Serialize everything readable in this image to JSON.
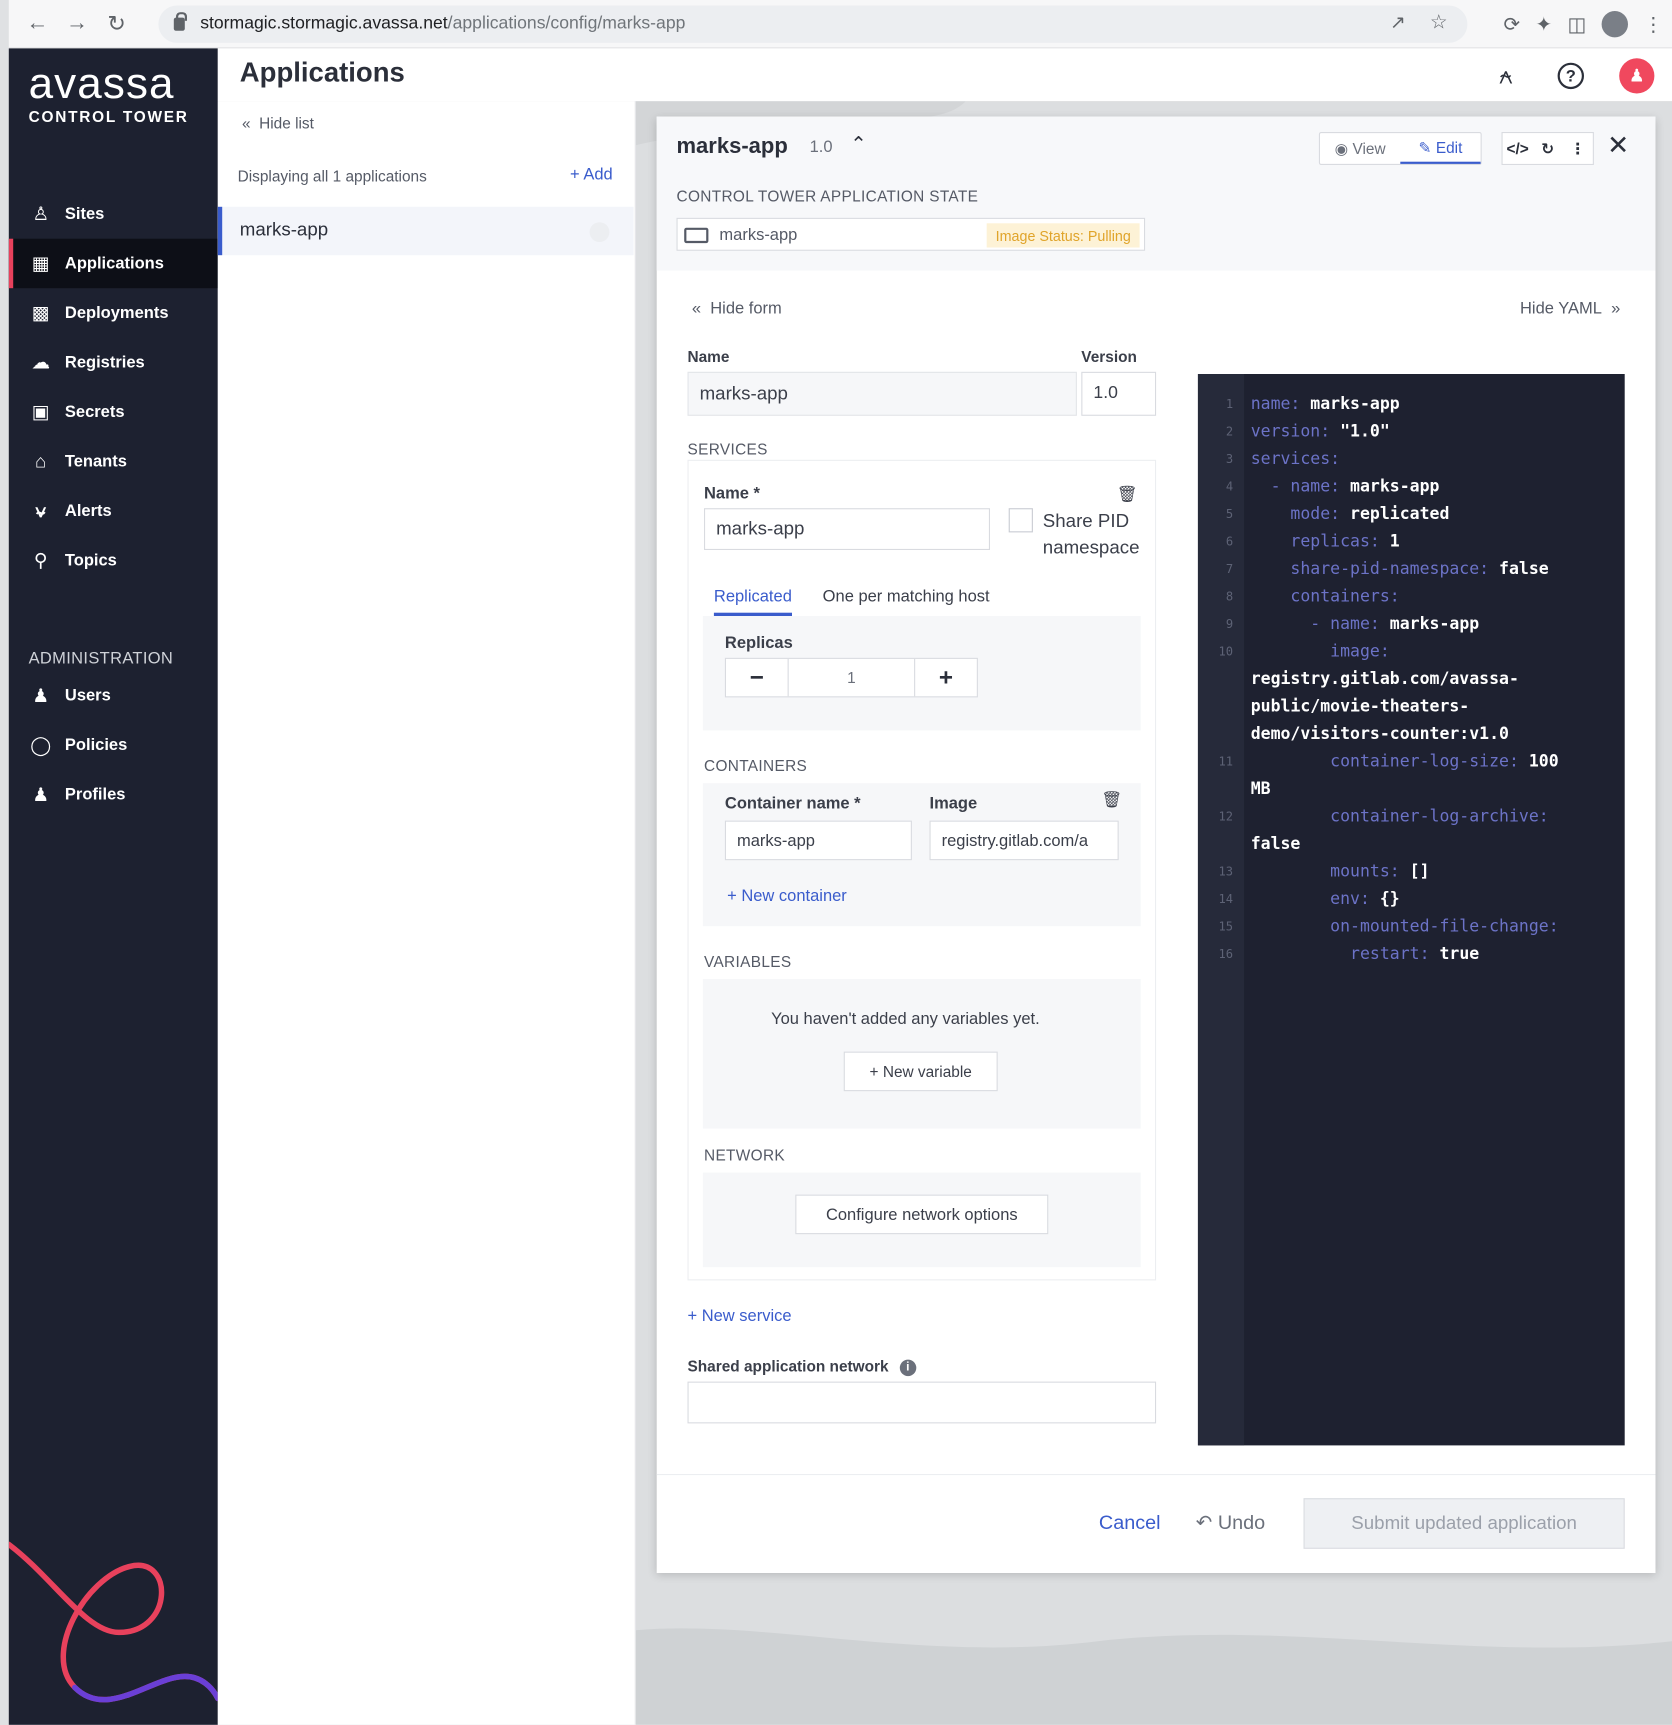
{
  "browser": {
    "url_host": "stormagic.stormagic.avassa.net",
    "url_path": "/applications/config/marks-app"
  },
  "brand": {
    "logo_word": "avassa",
    "logo_sub": "CONTROL TOWER",
    "accent": "#e8415c",
    "link": "#3a5ccc",
    "sidebar_bg": "#1d2130"
  },
  "sidebar": {
    "items": [
      {
        "label": "Sites",
        "icon": "sites-icon"
      },
      {
        "label": "Applications",
        "icon": "applications-icon"
      },
      {
        "label": "Deployments",
        "icon": "deployments-icon"
      },
      {
        "label": "Registries",
        "icon": "registries-icon"
      },
      {
        "label": "Secrets",
        "icon": "secrets-icon"
      },
      {
        "label": "Tenants",
        "icon": "tenants-icon"
      },
      {
        "label": "Alerts",
        "icon": "bell-icon"
      },
      {
        "label": "Topics",
        "icon": "search-icon"
      }
    ],
    "admin_title": "ADMINISTRATION",
    "admin_items": [
      {
        "label": "Users",
        "icon": "users-icon"
      },
      {
        "label": "Policies",
        "icon": "shield-icon"
      },
      {
        "label": "Profiles",
        "icon": "profiles-icon"
      }
    ]
  },
  "header": {
    "title": "Applications"
  },
  "list": {
    "hide_label": "Hide list",
    "displaying": "Displaying all 1 applications",
    "add_label": "+ Add",
    "rows": [
      {
        "label": "marks-app"
      }
    ]
  },
  "app": {
    "name": "marks-app",
    "version": "1.0",
    "view_label": "View",
    "edit_label": "Edit",
    "state_title": "CONTROL TOWER APPLICATION STATE",
    "state_name": "marks-app",
    "image_status": "Image Status: Pulling"
  },
  "form": {
    "hide_form": "Hide form",
    "hide_yaml": "Hide YAML",
    "name_label": "Name",
    "name_value": "marks-app",
    "version_label": "Version",
    "version_value": "1.0",
    "services_title": "SERVICES",
    "svc_name_label": "Name *",
    "svc_name_value": "marks-app",
    "share_pid_label": "Share PID",
    "share_pid_label2": "namespace",
    "tab_replicated": "Replicated",
    "tab_one_per_host": "One per matching host",
    "replicas_label": "Replicas",
    "replicas_value": "1",
    "containers_title": "CONTAINERS",
    "container_name_label": "Container name *",
    "container_name_value": "marks-app",
    "image_label": "Image",
    "image_value": "registry.gitlab.com/a",
    "new_container": "+ New container",
    "variables_title": "VARIABLES",
    "variables_empty": "You haven't added any variables yet.",
    "new_variable": "+ New variable",
    "network_title": "NETWORK",
    "configure_network": "Configure network options",
    "new_service": "+ New service",
    "shared_network_label": "Shared application network",
    "shared_network_value": ""
  },
  "yaml_lines": [
    {
      "n": "1",
      "indent": "",
      "k": "name:",
      "v": " marks-app"
    },
    {
      "n": "2",
      "indent": "",
      "k": "version:",
      "v": " \"1.0\""
    },
    {
      "n": "3",
      "indent": "",
      "k": "services:",
      "v": ""
    },
    {
      "n": "4",
      "indent": "  ",
      "k": "- name:",
      "v": " marks-app"
    },
    {
      "n": "5",
      "indent": "    ",
      "k": "mode:",
      "v": " replicated"
    },
    {
      "n": "6",
      "indent": "    ",
      "k": "replicas:",
      "v": " 1"
    },
    {
      "n": "7",
      "indent": "    ",
      "k": "share-pid-namespace:",
      "v": " false"
    },
    {
      "n": "8",
      "indent": "    ",
      "k": "containers:",
      "v": ""
    },
    {
      "n": "9",
      "indent": "      ",
      "k": "- name:",
      "v": " marks-app"
    },
    {
      "n": "10",
      "indent": "        ",
      "k": "image:",
      "v": ""
    },
    {
      "n": "",
      "indent": "",
      "k": "",
      "v": "registry.gitlab.com/avassa-"
    },
    {
      "n": "",
      "indent": "",
      "k": "",
      "v": "public/movie-theaters-"
    },
    {
      "n": "",
      "indent": "",
      "k": "",
      "v": "demo/visitors-counter:v1.0"
    },
    {
      "n": "11",
      "indent": "        ",
      "k": "container-log-size:",
      "v": " 100"
    },
    {
      "n": "",
      "indent": "",
      "k": "",
      "v": "MB"
    },
    {
      "n": "12",
      "indent": "        ",
      "k": "container-log-archive:",
      "v": ""
    },
    {
      "n": "",
      "indent": "",
      "k": "",
      "v": "false"
    },
    {
      "n": "13",
      "indent": "        ",
      "k": "mounts:",
      "v": " []"
    },
    {
      "n": "14",
      "indent": "        ",
      "k": "env:",
      "v": " {}"
    },
    {
      "n": "15",
      "indent": "        ",
      "k": "on-mounted-file-change:",
      "v": ""
    },
    {
      "n": "16",
      "indent": "          ",
      "k": "restart:",
      "v": " true"
    }
  ],
  "footer": {
    "cancel": "Cancel",
    "undo": "Undo",
    "submit": "Submit updated application"
  }
}
